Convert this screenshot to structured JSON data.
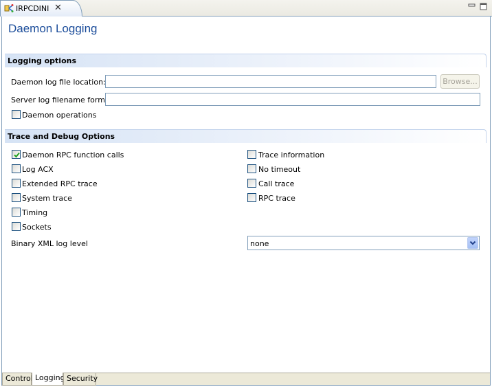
{
  "editor_tab": {
    "title": "IRPCDINI",
    "close": "✕"
  },
  "page": {
    "title": "Daemon Logging"
  },
  "logging_options": {
    "header": "Logging options",
    "log_file_label": "Daemon log file location:",
    "log_file_value": "",
    "browse_label": "Browse...",
    "filename_format_label": "Server log filename format:",
    "filename_format_value": "",
    "daemon_operations": {
      "label": "Daemon operations",
      "checked": false
    }
  },
  "trace_options": {
    "header": "Trace and Debug Options",
    "left": [
      {
        "label": "Daemon RPC function calls",
        "checked": true
      },
      {
        "label": "Log ACX",
        "checked": false
      },
      {
        "label": "Extended RPC trace",
        "checked": false
      },
      {
        "label": "System trace",
        "checked": false
      },
      {
        "label": "Timing",
        "checked": false
      },
      {
        "label": "Sockets",
        "checked": false
      }
    ],
    "right": [
      {
        "label": "Trace information",
        "checked": false
      },
      {
        "label": "No timeout",
        "checked": false
      },
      {
        "label": "Call trace",
        "checked": false
      },
      {
        "label": "RPC trace",
        "checked": false
      }
    ],
    "binary_xml_label": "Binary XML log level",
    "binary_xml_value": "none"
  },
  "bottom_tabs": [
    {
      "label": "Control",
      "active": false
    },
    {
      "label": "Logging",
      "active": true
    },
    {
      "label": "Security",
      "active": false
    }
  ],
  "colors": {
    "title": "#1d4e9b",
    "border": "#7f9db9"
  }
}
